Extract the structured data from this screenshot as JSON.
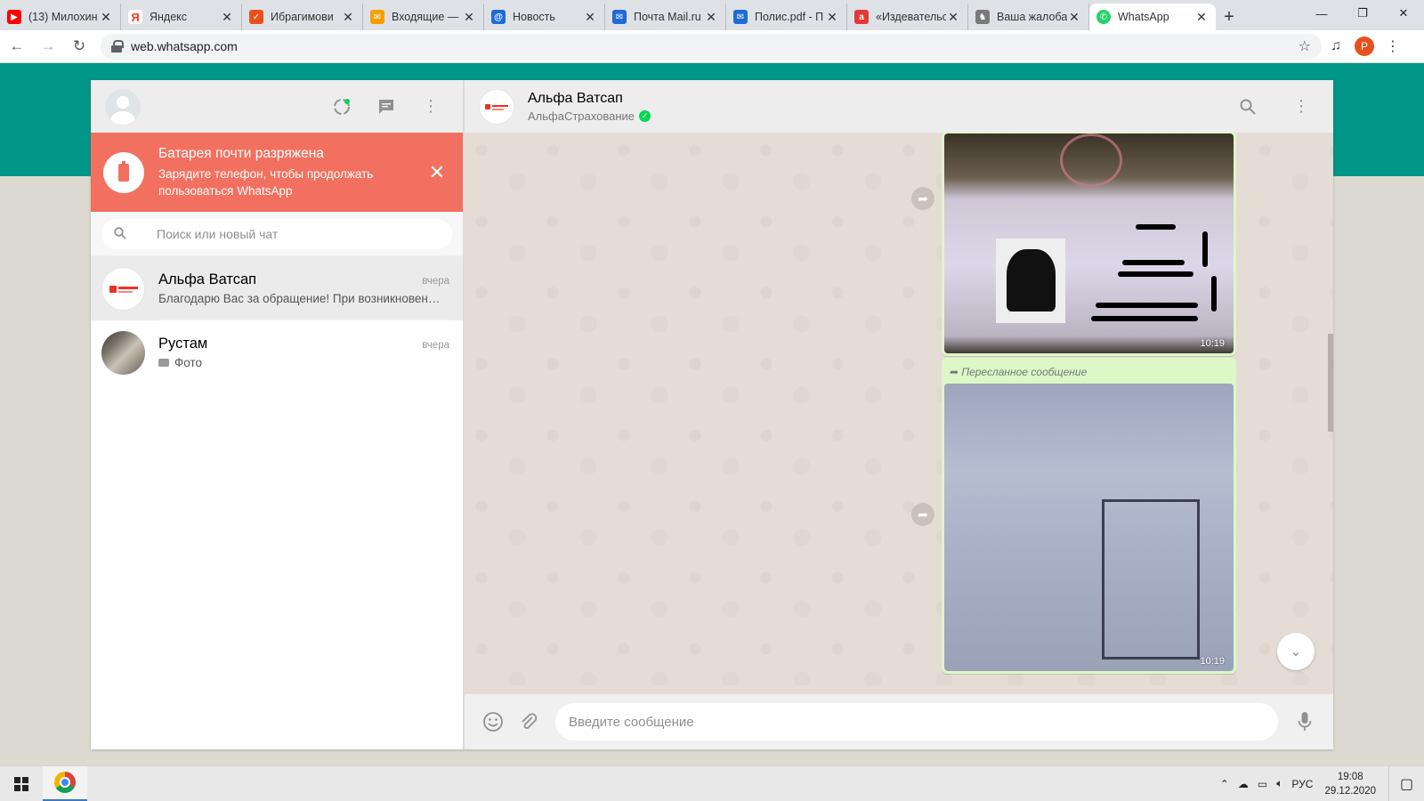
{
  "browser": {
    "tabs": [
      {
        "title": "(13) Милохин",
        "color": "#ff0000",
        "glyph": "▶"
      },
      {
        "title": "Яндекс",
        "color": "#fc3f1d",
        "glyph": "Я"
      },
      {
        "title": "Ибрагимови",
        "color": "#e8501e",
        "glyph": "✓"
      },
      {
        "title": "Входящие —",
        "color": "#f6a000",
        "glyph": "✉"
      },
      {
        "title": "Новость",
        "color": "#1e6bd6",
        "glyph": "@"
      },
      {
        "title": "Почта Mail.ru",
        "color": "#1e6bd6",
        "glyph": "✉"
      },
      {
        "title": "Полис.pdf - П",
        "color": "#1e6bd6",
        "glyph": "✉"
      },
      {
        "title": "«Издевательс",
        "color": "#e53935",
        "glyph": "a"
      },
      {
        "title": "Ваша жалоба",
        "color": "#7a7a7a",
        "glyph": "♞"
      },
      {
        "title": "WhatsApp",
        "color": "#25d366",
        "glyph": "✆"
      }
    ],
    "url": "web.whatsapp.com",
    "profile_initial": "P"
  },
  "sidebar": {
    "battery": {
      "title": "Батарея почти разряжена",
      "text": "Зарядите телефон, чтобы продолжать пользоваться WhatsApp"
    },
    "search_placeholder": "Поиск или новый чат",
    "chats": [
      {
        "name": "Альфа Ватсап",
        "time": "вчера",
        "preview": "Благодарю Вас за обращение! При возникновении вопросов"
      },
      {
        "name": "Рустам",
        "time": "вчера",
        "preview": "Фото"
      }
    ]
  },
  "conversation": {
    "name": "Альфа Ватсап",
    "subtitle": "АльфаСтрахование",
    "messages": [
      {
        "time": "10:19",
        "forwarded_label": ""
      },
      {
        "time": "10:19",
        "forwarded_label": "Пересланное сообщение"
      }
    ],
    "composer_placeholder": "Введите сообщение"
  },
  "taskbar": {
    "language": "РУС",
    "time": "19:08",
    "date": "29.12.2020"
  },
  "icons": {
    "status": "status-icon",
    "new_chat": "new-chat-icon",
    "menu": "menu-icon",
    "search": "search-icon",
    "emoji": "emoji-icon",
    "attach": "attach-icon",
    "mic": "mic-icon"
  },
  "colors": {
    "brand_green": "#009688",
    "battery_alert": "#f2705f",
    "bubble_out": "#dcf8c6",
    "chat_bg": "#e5ddd5"
  }
}
